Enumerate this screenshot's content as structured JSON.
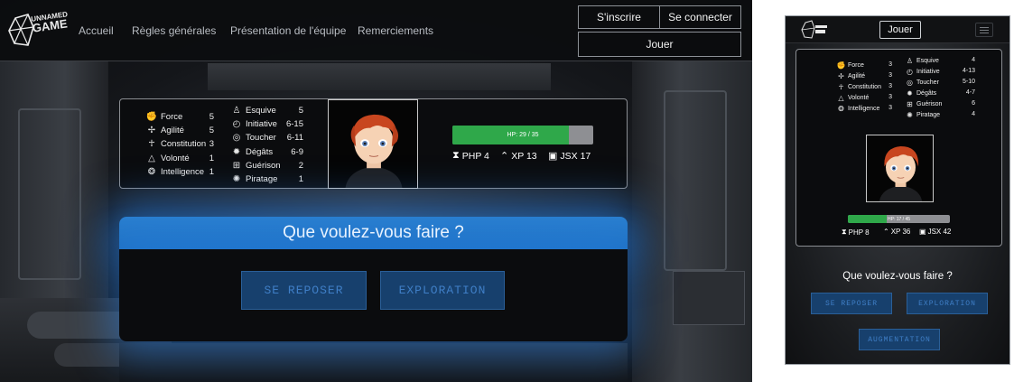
{
  "desktop": {
    "logo": {
      "text_line1": "UNNAMED",
      "text_line2": "GAME",
      "icon": "d20-dice-icon"
    },
    "nav": [
      {
        "label": "Accueil"
      },
      {
        "label": "Règles générales"
      },
      {
        "label": "Présentation de l'équipe"
      },
      {
        "label": "Remerciements"
      }
    ],
    "auth": {
      "signup": "S'inscrire",
      "login": "Se connecter",
      "play": "Jouer"
    },
    "stats_left": [
      {
        "label": "Force",
        "value": "5",
        "icon": "fist-icon"
      },
      {
        "label": "Agilité",
        "value": "5",
        "icon": "agility-icon"
      },
      {
        "label": "Constitution",
        "value": "3",
        "icon": "runner-icon"
      },
      {
        "label": "Volonté",
        "value": "1",
        "icon": "pyramid-icon"
      },
      {
        "label": "Intelligence",
        "value": "1",
        "icon": "brain-icon"
      }
    ],
    "stats_right": [
      {
        "label": "Esquive",
        "value": "5",
        "icon": "dodge-icon"
      },
      {
        "label": "Initiative",
        "value": "6-15",
        "icon": "stopwatch-icon"
      },
      {
        "label": "Toucher",
        "value": "6-11",
        "icon": "target-icon"
      },
      {
        "label": "Dégâts",
        "value": "6-9",
        "icon": "explosion-icon"
      },
      {
        "label": "Guérison",
        "value": "2",
        "icon": "medkit-icon"
      },
      {
        "label": "Piratage",
        "value": "1",
        "icon": "virus-icon"
      }
    ],
    "hp": {
      "label": "HP: 29 / 35",
      "current": 29,
      "max": 35
    },
    "resources": [
      {
        "label": "PHP 4",
        "icon": "hourglass-icon",
        "glyph": "⧗"
      },
      {
        "label": "XP 13",
        "icon": "chevron-up-icon",
        "glyph": "⌃"
      },
      {
        "label": "JSX 17",
        "icon": "banknote-icon",
        "glyph": "▣"
      }
    ],
    "prompt": "Que voulez-vous faire ?",
    "actions": [
      {
        "label": "SE REPOSER"
      },
      {
        "label": "EXPLORATION"
      }
    ]
  },
  "mobile": {
    "play": "Jouer",
    "stats_left": [
      {
        "label": "Force",
        "value": "3"
      },
      {
        "label": "Agilité",
        "value": "3"
      },
      {
        "label": "Constitution",
        "value": "3"
      },
      {
        "label": "Volonté",
        "value": "3"
      },
      {
        "label": "Intelligence",
        "value": "3"
      }
    ],
    "stats_right": [
      {
        "label": "Esquive",
        "value": "4"
      },
      {
        "label": "Initiative",
        "value": "4-13"
      },
      {
        "label": "Toucher",
        "value": "5-10"
      },
      {
        "label": "Dégâts",
        "value": "4-7"
      },
      {
        "label": "Guérison",
        "value": "6"
      },
      {
        "label": "Piratage",
        "value": "4"
      }
    ],
    "hp": {
      "label": "HP: 17 / 45",
      "current": 17,
      "max": 45
    },
    "resources": [
      {
        "label": "PHP 8",
        "glyph": "⧗"
      },
      {
        "label": "XP 36",
        "glyph": "⌃"
      },
      {
        "label": "JSX 42",
        "glyph": "▣"
      }
    ],
    "prompt": "Que voulez-vous faire ?",
    "actions": [
      {
        "label": "SE REPOSER"
      },
      {
        "label": "EXPLORATION"
      },
      {
        "label": "AUGMENTATION"
      }
    ]
  }
}
